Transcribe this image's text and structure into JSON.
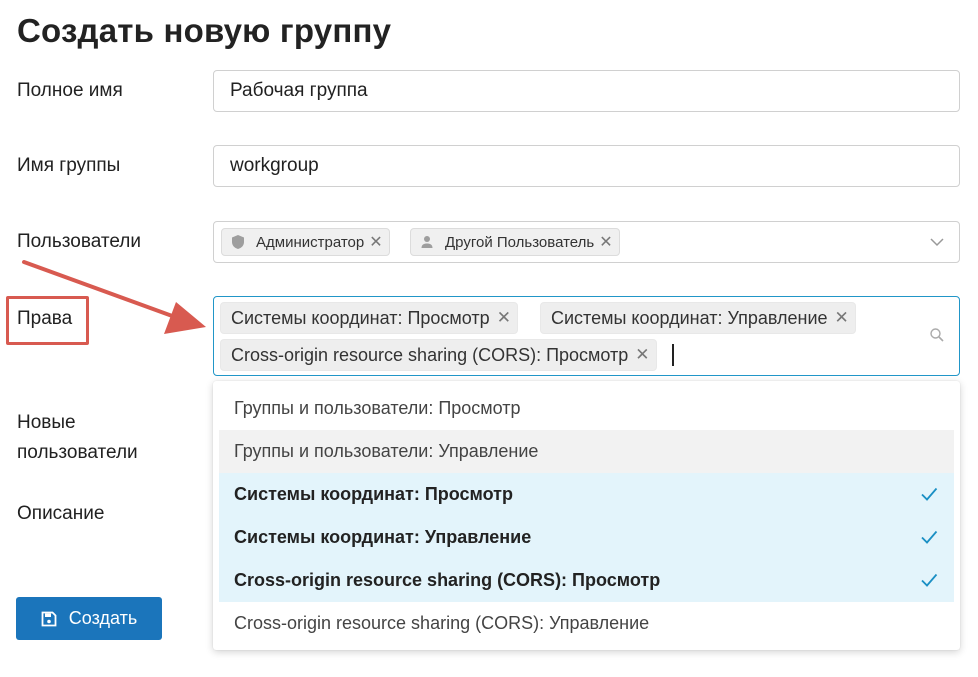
{
  "page": {
    "title": "Создать новую группу"
  },
  "form": {
    "full_name": {
      "label": "Полное имя",
      "value": "Рабочая группа"
    },
    "group_name": {
      "label": "Имя группы",
      "value": "workgroup"
    },
    "users": {
      "label": "Пользователи",
      "tags": [
        {
          "label": "Администратор",
          "icon": "shield-icon"
        },
        {
          "label": "Другой Пользователь",
          "icon": "user-icon"
        }
      ]
    },
    "rights": {
      "label": "Права",
      "tags": [
        "Системы координат: Просмотр",
        "Системы координат: Управление",
        "Cross-origin resource sharing (CORS): Просмотр"
      ]
    },
    "new_users": {
      "label": "Новые\nпользователи"
    },
    "description": {
      "label": "Описание"
    },
    "submit_label": "Создать"
  },
  "dropdown": {
    "options": [
      {
        "label": "Группы и пользователи: Просмотр",
        "selected": false
      },
      {
        "label": "Группы и пользователи: Управление",
        "selected": false,
        "hovered": true
      },
      {
        "label": "Системы координат: Просмотр",
        "selected": true
      },
      {
        "label": "Системы координат: Управление",
        "selected": true
      },
      {
        "label": "Cross-origin resource sharing (CORS): Просмотр",
        "selected": true
      },
      {
        "label": "Cross-origin resource sharing (CORS): Управление",
        "selected": false
      }
    ]
  },
  "colors": {
    "accent": "#1b75bb",
    "focus_border": "#2196c8",
    "annotation": "#d85a50",
    "selected_bg": "#e3f4fb",
    "check": "#1a8fc4"
  }
}
